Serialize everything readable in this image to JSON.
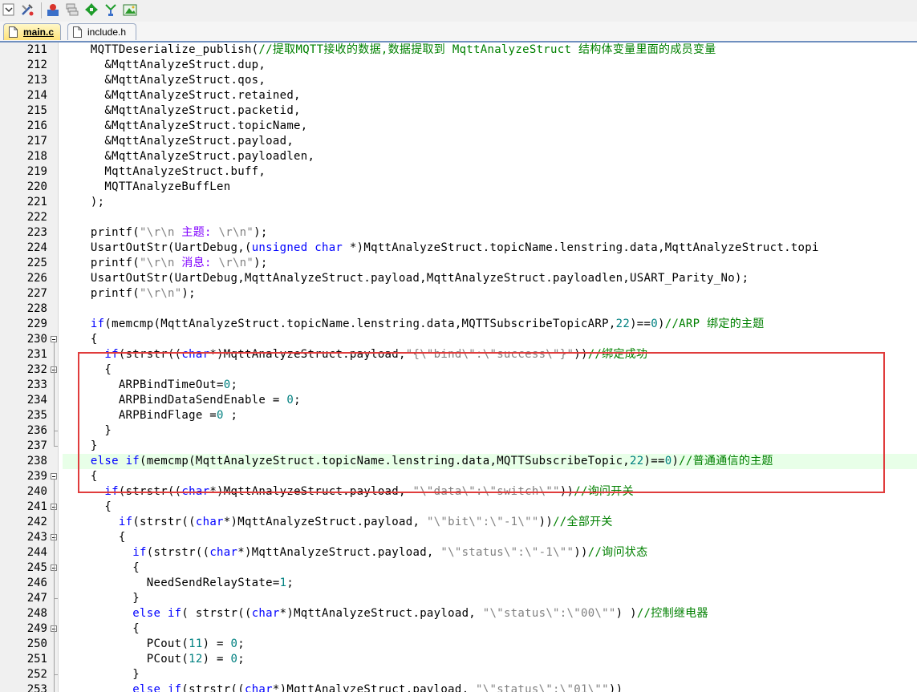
{
  "toolbar": {
    "icons": [
      "dropdown-icon",
      "tools-icon",
      "person-icon",
      "tile-windows-icon",
      "green-arrows-icon",
      "flow-icon",
      "picture-icon"
    ]
  },
  "tabs": [
    {
      "label": "main.c",
      "active": true
    },
    {
      "label": "include.h",
      "active": false
    }
  ],
  "lines": [
    {
      "n": "211",
      "segs": [
        {
          "t": "    MQTTDeserialize_publish("
        },
        {
          "t": "//提取MQTT接收的数据,数据提取到 MqttAnalyzeStruct 结构体变量里面的成员变量",
          "c": "cm"
        }
      ]
    },
    {
      "n": "212",
      "segs": [
        {
          "t": "      &MqttAnalyzeStruct.dup,"
        }
      ]
    },
    {
      "n": "213",
      "segs": [
        {
          "t": "      &MqttAnalyzeStruct.qos,"
        }
      ]
    },
    {
      "n": "214",
      "segs": [
        {
          "t": "      &MqttAnalyzeStruct.retained,"
        }
      ]
    },
    {
      "n": "215",
      "segs": [
        {
          "t": "      &MqttAnalyzeStruct.packetid,"
        }
      ]
    },
    {
      "n": "216",
      "segs": [
        {
          "t": "      &MqttAnalyzeStruct.topicName,"
        }
      ]
    },
    {
      "n": "217",
      "segs": [
        {
          "t": "      &MqttAnalyzeStruct.payload,"
        }
      ]
    },
    {
      "n": "218",
      "segs": [
        {
          "t": "      &MqttAnalyzeStruct.payloadlen,"
        }
      ]
    },
    {
      "n": "219",
      "segs": [
        {
          "t": "      MqttAnalyzeStruct.buff,"
        }
      ]
    },
    {
      "n": "220",
      "segs": [
        {
          "t": "      MQTTAnalyzeBuffLen"
        }
      ]
    },
    {
      "n": "221",
      "segs": [
        {
          "t": "    );"
        }
      ]
    },
    {
      "n": "222",
      "segs": [
        {
          "t": ""
        }
      ]
    },
    {
      "n": "223",
      "segs": [
        {
          "t": "    printf("
        },
        {
          "t": "\"",
          "c": "st"
        },
        {
          "t": "\\r\\n",
          "c": "esc"
        },
        {
          "t": " 主题: ",
          "c": "sq"
        },
        {
          "t": "\\r\\n",
          "c": "esc"
        },
        {
          "t": "\"",
          "c": "st"
        },
        {
          "t": ");"
        }
      ]
    },
    {
      "n": "224",
      "segs": [
        {
          "t": "    UsartOutStr(UartDebug,("
        },
        {
          "t": "unsigned char",
          "c": "kw"
        },
        {
          "t": " *)MqttAnalyzeStruct.topicName.lenstring.data,MqttAnalyzeStruct.topi"
        }
      ]
    },
    {
      "n": "225",
      "segs": [
        {
          "t": "    printf("
        },
        {
          "t": "\"",
          "c": "st"
        },
        {
          "t": "\\r\\n",
          "c": "esc"
        },
        {
          "t": " 消息: ",
          "c": "sq"
        },
        {
          "t": "\\r\\n",
          "c": "esc"
        },
        {
          "t": "\"",
          "c": "st"
        },
        {
          "t": ");"
        }
      ]
    },
    {
      "n": "226",
      "segs": [
        {
          "t": "    UsartOutStr(UartDebug,MqttAnalyzeStruct.payload,MqttAnalyzeStruct.payloadlen,USART_Parity_No);"
        }
      ]
    },
    {
      "n": "227",
      "segs": [
        {
          "t": "    printf("
        },
        {
          "t": "\"",
          "c": "st"
        },
        {
          "t": "\\r\\n",
          "c": "esc"
        },
        {
          "t": "\"",
          "c": "st"
        },
        {
          "t": ");"
        }
      ]
    },
    {
      "n": "228",
      "segs": [
        {
          "t": ""
        }
      ]
    },
    {
      "n": "229",
      "segs": [
        {
          "t": "    "
        },
        {
          "t": "if",
          "c": "kw"
        },
        {
          "t": "(memcmp(MqttAnalyzeStruct.topicName.lenstring.data,MQTTSubscribeTopicARP,"
        },
        {
          "t": "22",
          "c": "nm"
        },
        {
          "t": ")=="
        },
        {
          "t": "0",
          "c": "nm"
        },
        {
          "t": ")"
        },
        {
          "t": "//ARP 绑定的主题",
          "c": "cm"
        }
      ]
    },
    {
      "n": "230",
      "segs": [
        {
          "t": "    {"
        }
      ],
      "fold": "open"
    },
    {
      "n": "231",
      "segs": [
        {
          "t": "      "
        },
        {
          "t": "if",
          "c": "kw"
        },
        {
          "t": "(strstr(("
        },
        {
          "t": "char",
          "c": "kw"
        },
        {
          "t": "*)MqttAnalyzeStruct.payload,"
        },
        {
          "t": "\"{\\\"bind\\\":\\\"success\\\"}\"",
          "c": "st"
        },
        {
          "t": "))"
        },
        {
          "t": "//绑定成功",
          "c": "cm"
        }
      ]
    },
    {
      "n": "232",
      "segs": [
        {
          "t": "      {"
        }
      ],
      "fold": "open"
    },
    {
      "n": "233",
      "segs": [
        {
          "t": "        ARPBindTimeOut="
        },
        {
          "t": "0",
          "c": "nm"
        },
        {
          "t": ";"
        }
      ]
    },
    {
      "n": "234",
      "segs": [
        {
          "t": "        ARPBindDataSendEnable = "
        },
        {
          "t": "0",
          "c": "nm"
        },
        {
          "t": ";"
        }
      ]
    },
    {
      "n": "235",
      "segs": [
        {
          "t": "        ARPBindFlage ="
        },
        {
          "t": "0",
          "c": "nm"
        },
        {
          "t": " ;"
        }
      ]
    },
    {
      "n": "236",
      "segs": [
        {
          "t": "      }"
        }
      ],
      "fold": "end"
    },
    {
      "n": "237",
      "segs": [
        {
          "t": "    }"
        }
      ],
      "fold": "end"
    },
    {
      "n": "238",
      "segs": [
        {
          "t": "    "
        },
        {
          "t": "else if",
          "c": "kw"
        },
        {
          "t": "(memcmp(MqttAnalyzeStruct.topicName.lenstring.data,MQTTSubscribeTopic,"
        },
        {
          "t": "22",
          "c": "nm"
        },
        {
          "t": ")=="
        },
        {
          "t": "0",
          "c": "nm"
        },
        {
          "t": ")"
        },
        {
          "t": "//普通通信的主题",
          "c": "cm"
        }
      ],
      "hl": true
    },
    {
      "n": "239",
      "segs": [
        {
          "t": "    {"
        }
      ],
      "fold": "open"
    },
    {
      "n": "240",
      "segs": [
        {
          "t": "      "
        },
        {
          "t": "if",
          "c": "kw"
        },
        {
          "t": "(strstr(("
        },
        {
          "t": "char",
          "c": "kw"
        },
        {
          "t": "*)MqttAnalyzeStruct.payload, "
        },
        {
          "t": "\"\\\"data\\\":\\\"switch\\\"\"",
          "c": "st"
        },
        {
          "t": "))"
        },
        {
          "t": "//询问开关",
          "c": "cm"
        }
      ]
    },
    {
      "n": "241",
      "segs": [
        {
          "t": "      {"
        }
      ],
      "fold": "open"
    },
    {
      "n": "242",
      "segs": [
        {
          "t": "        "
        },
        {
          "t": "if",
          "c": "kw"
        },
        {
          "t": "(strstr(("
        },
        {
          "t": "char",
          "c": "kw"
        },
        {
          "t": "*)MqttAnalyzeStruct.payload, "
        },
        {
          "t": "\"\\\"bit\\\":\\\"-1\\\"\"",
          "c": "st"
        },
        {
          "t": "))"
        },
        {
          "t": "//全部开关",
          "c": "cm"
        }
      ]
    },
    {
      "n": "243",
      "segs": [
        {
          "t": "        {"
        }
      ],
      "fold": "open"
    },
    {
      "n": "244",
      "segs": [
        {
          "t": "          "
        },
        {
          "t": "if",
          "c": "kw"
        },
        {
          "t": "(strstr(("
        },
        {
          "t": "char",
          "c": "kw"
        },
        {
          "t": "*)MqttAnalyzeStruct.payload, "
        },
        {
          "t": "\"\\\"status\\\":\\\"-1\\\"\"",
          "c": "st"
        },
        {
          "t": "))"
        },
        {
          "t": "//询问状态",
          "c": "cm"
        }
      ]
    },
    {
      "n": "245",
      "segs": [
        {
          "t": "          {"
        }
      ],
      "fold": "open"
    },
    {
      "n": "246",
      "segs": [
        {
          "t": "            NeedSendRelayState="
        },
        {
          "t": "1",
          "c": "nm"
        },
        {
          "t": ";"
        }
      ]
    },
    {
      "n": "247",
      "segs": [
        {
          "t": "          }"
        }
      ],
      "fold": "end"
    },
    {
      "n": "248",
      "segs": [
        {
          "t": "          "
        },
        {
          "t": "else if",
          "c": "kw"
        },
        {
          "t": "( strstr(("
        },
        {
          "t": "char",
          "c": "kw"
        },
        {
          "t": "*)MqttAnalyzeStruct.payload, "
        },
        {
          "t": "\"\\\"status\\\":\\\"00\\\"\"",
          "c": "st"
        },
        {
          "t": ") )"
        },
        {
          "t": "//控制继电器",
          "c": "cm"
        }
      ]
    },
    {
      "n": "249",
      "segs": [
        {
          "t": "          {"
        }
      ],
      "fold": "open"
    },
    {
      "n": "250",
      "segs": [
        {
          "t": "            PCout("
        },
        {
          "t": "11",
          "c": "nm"
        },
        {
          "t": ") = "
        },
        {
          "t": "0",
          "c": "nm"
        },
        {
          "t": ";"
        }
      ]
    },
    {
      "n": "251",
      "segs": [
        {
          "t": "            PCout("
        },
        {
          "t": "12",
          "c": "nm"
        },
        {
          "t": ") = "
        },
        {
          "t": "0",
          "c": "nm"
        },
        {
          "t": ";"
        }
      ]
    },
    {
      "n": "252",
      "segs": [
        {
          "t": "          }"
        }
      ],
      "fold": "end"
    },
    {
      "n": "253",
      "segs": [
        {
          "t": "          "
        },
        {
          "t": "else if",
          "c": "kw"
        },
        {
          "t": "(strstr(("
        },
        {
          "t": "char",
          "c": "kw"
        },
        {
          "t": "*)MqttAnalyzeStruct.payload, "
        },
        {
          "t": "\"\\\"status\\\":\\\"01\\\"\"",
          "c": "st"
        },
        {
          "t": "))"
        }
      ]
    }
  ],
  "colors": {
    "keyword": "#0000ff",
    "comment": "#008000",
    "string": "#808080",
    "number": "#008080",
    "highlight_box": "#e03c3c",
    "current_line": "#e8ffe8"
  }
}
